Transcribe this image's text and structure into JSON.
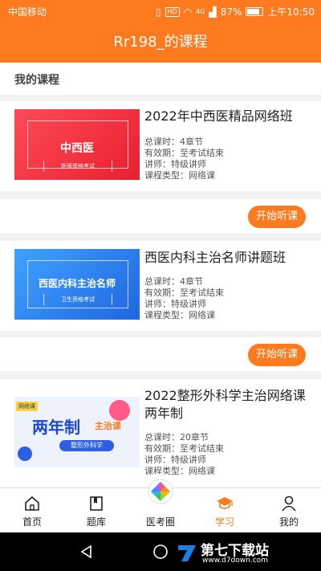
{
  "status": {
    "carrier": "中国移动",
    "battery": "87%",
    "time": "上午10:50",
    "network": "4G",
    "hd": "HD"
  },
  "header": {
    "title": "Rr198_的课程"
  },
  "section": {
    "title": "我的课程"
  },
  "labels": {
    "hours": "总课时：",
    "validity": "有效期：",
    "lecturer": "讲师：",
    "type": "课程类型："
  },
  "courses": [
    {
      "title": "2022年中西医精品网络班",
      "hours": "4章节",
      "validity": "至考试结束",
      "lecturer": "特级讲师",
      "type": "网络课",
      "start_label": "开始听课",
      "thumb": {
        "main": "中西医",
        "sub": "医师资格考试",
        "color": "#e8202e"
      }
    },
    {
      "title": "西医内科主治名师讲题班",
      "hours": "4章节",
      "validity": "至考试结束",
      "lecturer": "特级讲师",
      "type": "网络课",
      "start_label": "开始听课",
      "thumb": {
        "main": "西医内科主治名师",
        "sub": "卫生资格考试",
        "color": "#1f66e0"
      }
    },
    {
      "title": "2022整形外科学主治网络课两年制",
      "hours": "20章节",
      "validity": "至考试结束",
      "lecturer": "特级讲师",
      "type": "网络课",
      "thumb": {
        "chip": "网络课",
        "main": "两年制",
        "tag": "主治课",
        "pill": "整形外科学"
      }
    }
  ],
  "tabbar": {
    "items": [
      {
        "label": "首页",
        "icon": "home-icon"
      },
      {
        "label": "题库",
        "icon": "book-icon"
      },
      {
        "label": "医考圈",
        "icon": "aperture-icon"
      },
      {
        "label": "学习",
        "icon": "graduation-cap-icon",
        "active": true
      },
      {
        "label": "我的",
        "icon": "person-icon"
      }
    ]
  },
  "watermark": {
    "text": "第七下载站",
    "url": "www.d7down.com"
  },
  "colors": {
    "accent": "#fd7a1e",
    "background": "#f2f2f2"
  }
}
